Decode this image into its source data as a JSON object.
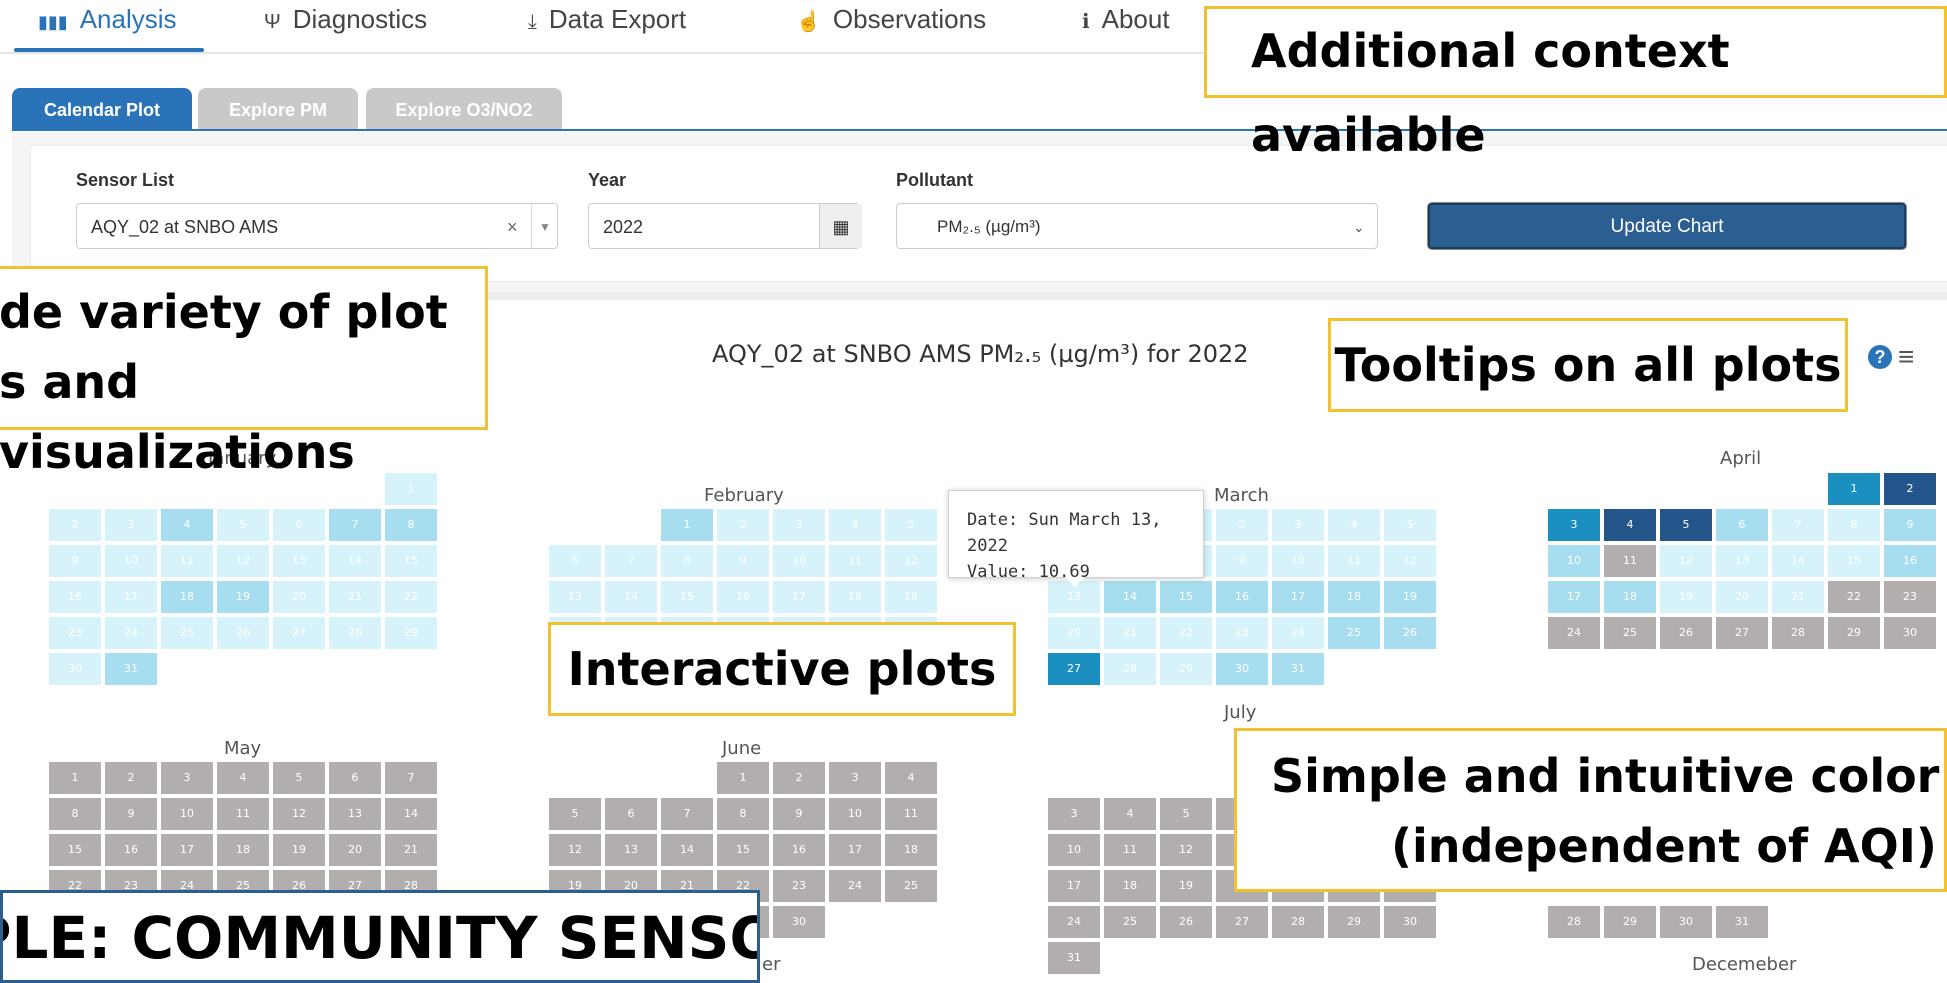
{
  "nav": {
    "items": [
      {
        "label": "Analysis",
        "icon": "bar-chart-icon",
        "glyph": "📊"
      },
      {
        "label": "Diagnostics",
        "icon": "stethoscope-icon",
        "glyph": "Ψ"
      },
      {
        "label": "Data Export",
        "icon": "download-icon",
        "glyph": "⤓"
      },
      {
        "label": "Observations",
        "icon": "hand-icon",
        "glyph": "☝"
      },
      {
        "label": "About",
        "icon": "info-icon",
        "glyph": "ℹ"
      }
    ]
  },
  "subtabs": [
    "Calendar Plot",
    "Explore PM",
    "Explore O3/NO2"
  ],
  "form": {
    "sensor_label": "Sensor List",
    "sensor_value": "AQY_02 at SNBO AMS",
    "year_label": "Year",
    "year_value": "2022",
    "pollutant_label": "Pollutant",
    "pollutant_value": "PM₂.₅ (µg/m³)",
    "update_label": "Update Chart"
  },
  "chart": {
    "title": "AQY_02 at SNBO AMS PM₂.₅ (µg/m³) for 2022",
    "help_glyph": "?",
    "menu_glyph": "≡"
  },
  "tooltip": {
    "date": "Date: Sun March 13, 2022",
    "value": "Value: 10.69"
  },
  "chart_data": {
    "type": "heatmap",
    "year": 2022,
    "months": [
      "January",
      "February",
      "March",
      "April",
      "May",
      "June",
      "July",
      "Decemeber"
    ],
    "colors": {
      "very_light": "#d6f3fb",
      "light": "#a6def0",
      "medium": "#1a8fc0",
      "dark": "#24558a",
      "no_data": "#b3aeae"
    },
    "highlighted_values": [
      {
        "date": "2022-03-13",
        "value": 10.69
      }
    ]
  },
  "callouts": {
    "context": "Additional context available",
    "variety_1": "de variety of plot",
    "variety_2": "s and visualizations",
    "tooltips": "Tooltips on all plots",
    "interactive": "Interactive plots",
    "color_1": "Simple and intuitive color sc",
    "color_2": "(independent of AQI)",
    "community": "PLE: COMMUNITY SENSOR"
  },
  "partial_label": "er"
}
